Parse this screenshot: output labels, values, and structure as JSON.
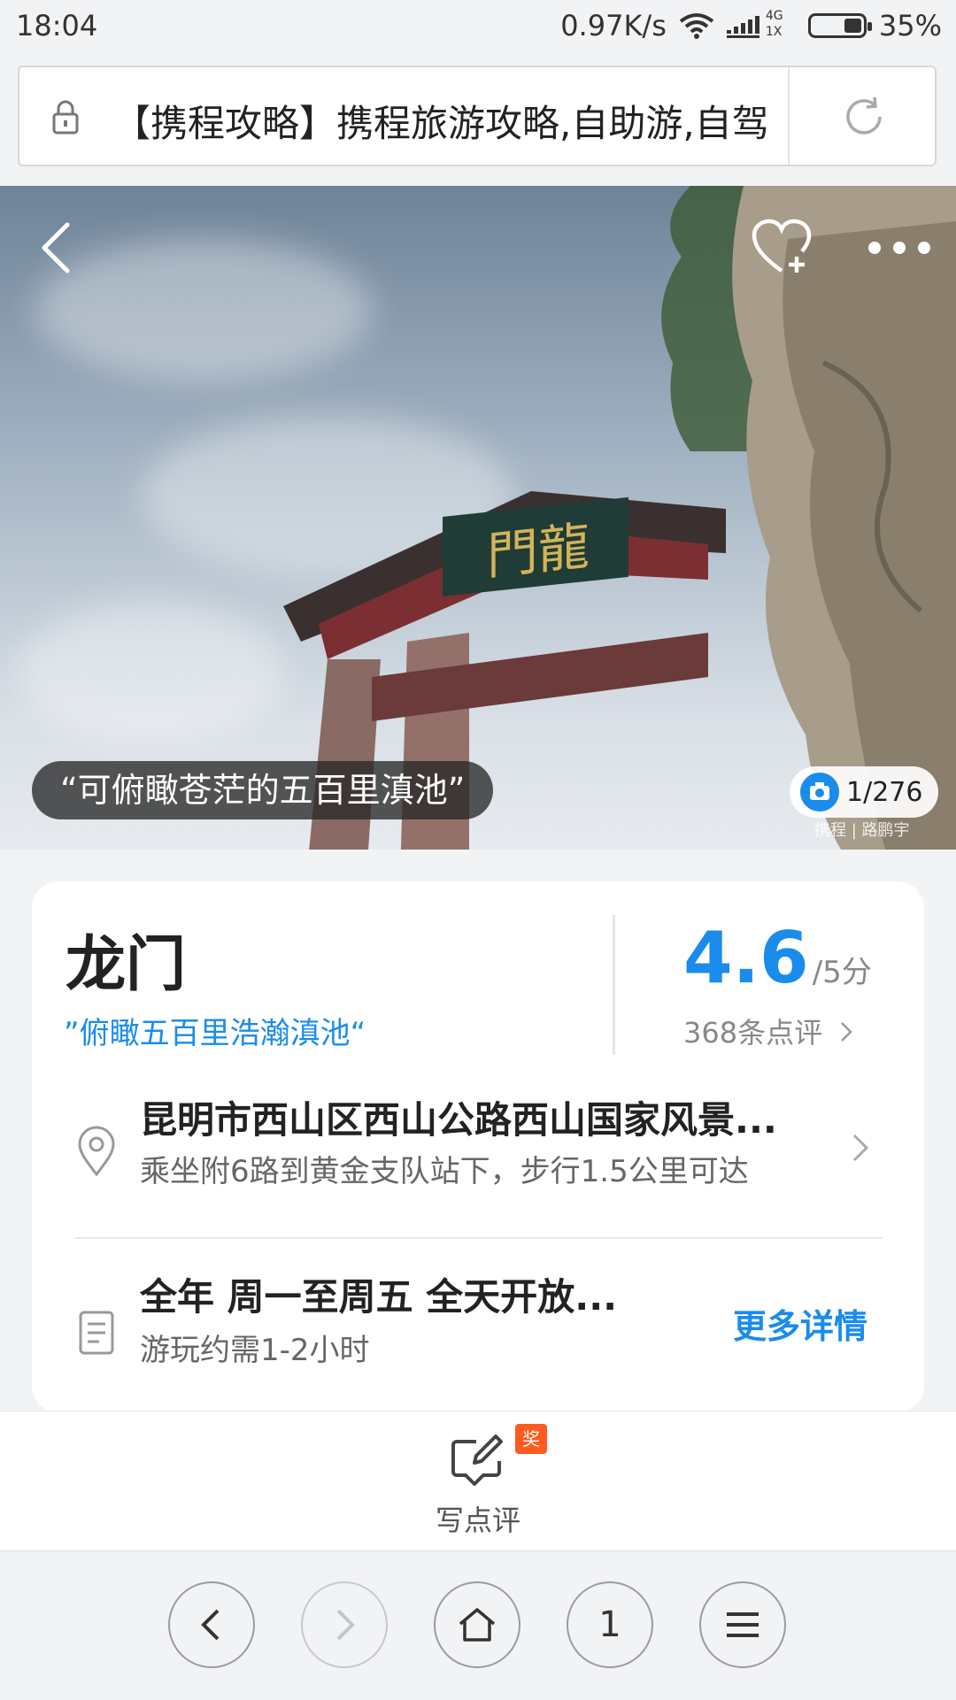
{
  "status_bar": {
    "time": "18:04",
    "net_speed": "0.97K/s",
    "network_type_top": "4G",
    "network_type_bottom": "1X",
    "battery_percent": "35%",
    "battery_level": 0.35
  },
  "browser": {
    "url_text": "【携程攻略】携程旅游攻略,自助游,自驾",
    "tab_count": "1"
  },
  "hero": {
    "quote": "“可俯瞰苍茫的五百里滇池”",
    "photo_counter": "1/276",
    "watermark": "携程 | 路鹏宇"
  },
  "poi": {
    "name": "龙门",
    "tagline": "”俯瞰五百里浩瀚滇池“",
    "score": "4.6",
    "score_max": "/5分",
    "review_count_text": "368条点评",
    "address_title": "昆明市西山区西山公路西山国家风景...",
    "address_sub": "乘坐附6路到黄金支队站下，步行1.5公里可达",
    "hours_title": "全年 周一至周五 全天开放...",
    "hours_sub": "游玩约需1-2小时",
    "more_label": "更多详情"
  },
  "review_bar": {
    "badge": "奖",
    "label": "写点评"
  },
  "colors": {
    "accent": "#1a8ceb",
    "badge": "#ff5a1f"
  }
}
